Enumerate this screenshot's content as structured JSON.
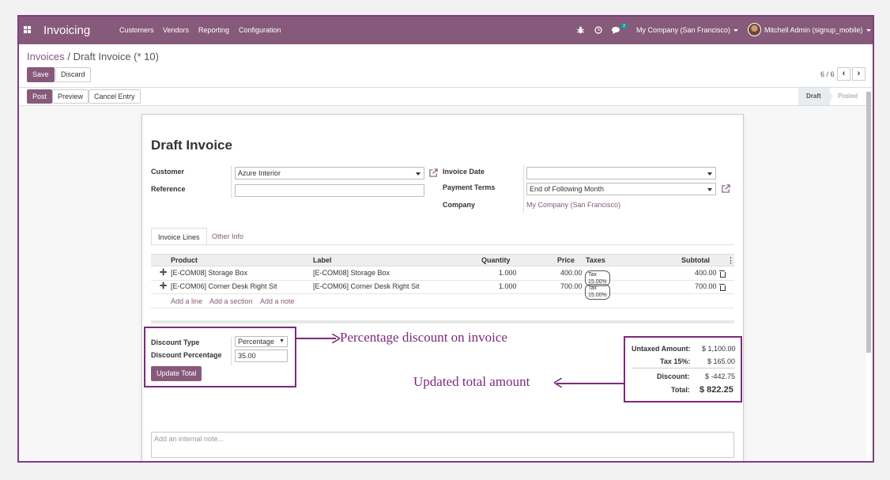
{
  "navbar": {
    "app_name": "Invoicing",
    "menu": [
      "Customers",
      "Vendors",
      "Reporting",
      "Configuration"
    ],
    "chat_count": "3",
    "company": "My Company (San Francisco)",
    "user": "Mitchell Admin (signup_mobile)"
  },
  "breadcrumb": {
    "parent": "Invoices",
    "separator": "/",
    "current": "Draft Invoice (* 10)"
  },
  "actions": {
    "save": "Save",
    "discard": "Discard"
  },
  "pager": {
    "value": "6 / 6",
    "prev": "‹",
    "next": "›"
  },
  "header_buttons": {
    "post": "Post",
    "preview": "Preview",
    "cancel": "Cancel Entry"
  },
  "status": {
    "draft": "Draft",
    "posted": "Posted"
  },
  "form": {
    "title": "Draft Invoice",
    "customer_label": "Customer",
    "customer_value": "Azure Interior",
    "reference_label": "Reference",
    "reference_value": "",
    "invoice_date_label": "Invoice Date",
    "invoice_date_value": "",
    "payment_terms_label": "Payment Terms",
    "payment_terms_value": "End of Following Month",
    "company_label": "Company",
    "company_value": "My Company (San Francisco)"
  },
  "tabs": {
    "lines": "Invoice Lines",
    "other": "Other Info"
  },
  "table": {
    "headers": {
      "product": "Product",
      "label": "Label",
      "quantity": "Quantity",
      "price": "Price",
      "taxes": "Taxes",
      "subtotal": "Subtotal"
    },
    "rows": [
      {
        "product": "[E-COM08] Storage Box",
        "label": "[E-COM08] Storage Box",
        "quantity": "1.000",
        "price": "400.00",
        "tax": "Tax 15.00%",
        "subtotal": "400.00"
      },
      {
        "product": "[E-COM06] Corner Desk Right Sit",
        "label": "[E-COM06] Corner Desk Right Sit",
        "quantity": "1.000",
        "price": "700.00",
        "tax": "Tax 15.00%",
        "subtotal": "700.00"
      }
    ],
    "add_line": "Add a line",
    "add_section": "Add a section",
    "add_note": "Add a note"
  },
  "discount": {
    "type_label": "Discount Type",
    "type_value": "Percentage",
    "percent_label": "Discount Percentage",
    "percent_value": "35.00",
    "update_button": "Update Total"
  },
  "totals": {
    "untaxed_label": "Untaxed Amount:",
    "untaxed_value": "$ 1,100.00",
    "tax_label": "Tax 15%:",
    "tax_value": "$ 165.00",
    "discount_label": "Discount:",
    "discount_value": "$ -442.75",
    "total_label": "Total:",
    "total_value": "$ 822.25"
  },
  "annotations": {
    "discount_note": "Percentage discount on invoice",
    "total_note": "Updated total amount"
  },
  "internal_note_placeholder": "Add an internal note...",
  "colors": {
    "brand": "#875a7b",
    "annotation": "#7c2a7a"
  }
}
